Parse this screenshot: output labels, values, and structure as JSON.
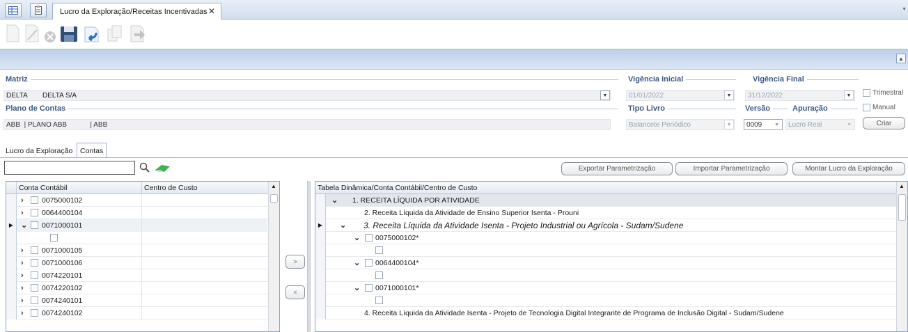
{
  "tabs": {
    "doc_tab_label": "Lucro da Exploração/Receitas Incentivadas",
    "close": "✕"
  },
  "form": {
    "matriz_label": "Matriz",
    "matriz_code": "DELTA",
    "matriz_name": "DELTA S/A",
    "plano_label": "Plano de Contas",
    "plano_value": "ABB  | PLANO ABB            | ABB",
    "vig_ini_label": "Vigência Inicial",
    "vig_ini_value": "01/01/2022",
    "vig_fim_label": "Vigência Final",
    "vig_fim_value": "31/12/2022",
    "trimestral_label": "Trimestral",
    "manual_label": "Manual",
    "tipo_label": "Tipo Livro",
    "tipo_value": "Balancete Periódico",
    "versao_label": "Versão",
    "versao_value": "0009",
    "apuracao_label": "Apuração",
    "apuracao_value": "Lucro Real",
    "criar_label": "Criar"
  },
  "inner_tabs": [
    "Lucro da Exploração",
    "Contas"
  ],
  "actions": {
    "exportar": "Exportar Parametrização",
    "importar": "Importar Parametrização",
    "montar": "Montar Lucro da Exploração"
  },
  "search": {
    "value": ""
  },
  "left_grid": {
    "headers": [
      "Conta Contábil",
      "Centro de Custo"
    ],
    "rows": [
      {
        "exp": ">",
        "code": "0075000102",
        "current": false
      },
      {
        "exp": ">",
        "code": "0064400104",
        "current": false
      },
      {
        "exp": "v",
        "code": "0071000101",
        "current": true
      },
      {
        "exp": "",
        "code": "",
        "current": false,
        "child": true
      },
      {
        "exp": ">",
        "code": "0071000105",
        "current": false
      },
      {
        "exp": ">",
        "code": "0071000106",
        "current": false
      },
      {
        "exp": ">",
        "code": "0074220101",
        "current": false
      },
      {
        "exp": ">",
        "code": "0074220102",
        "current": false
      },
      {
        "exp": ">",
        "code": "0074240101",
        "current": false
      },
      {
        "exp": ">",
        "code": "0074240102",
        "current": false
      }
    ]
  },
  "transfer": {
    "right": ">",
    "left": "<"
  },
  "right_grid": {
    "header": "Tabela Dinâmica/Conta Contábil/Centro de Custo",
    "rows": [
      {
        "level": 0,
        "exp": "v",
        "text": "1. RECEITA LÍQUIDA POR ATIVIDADE",
        "check": false,
        "style": "group"
      },
      {
        "level": 1,
        "exp": "",
        "text": "2. Receita Líquida da Atividade de Ensino Superior Isenta - Prouni",
        "check": false,
        "style": ""
      },
      {
        "level": 1,
        "exp": "v",
        "text": "3. Receita Líquida da Atividade Isenta - Projeto Industrial ou Agrícola - Sudam/Sudene",
        "check": false,
        "style": "italic",
        "current": true
      },
      {
        "level": 2,
        "exp": "v",
        "text": "0075000102*",
        "check": true,
        "style": ""
      },
      {
        "level": 3,
        "exp": "",
        "text": "",
        "check": true,
        "style": ""
      },
      {
        "level": 2,
        "exp": "v",
        "text": "0064400104*",
        "check": true,
        "style": ""
      },
      {
        "level": 3,
        "exp": "",
        "text": "",
        "check": true,
        "style": ""
      },
      {
        "level": 2,
        "exp": "v",
        "text": "0071000101*",
        "check": true,
        "style": ""
      },
      {
        "level": 3,
        "exp": "",
        "text": "",
        "check": true,
        "style": ""
      },
      {
        "level": 1,
        "exp": "",
        "text": "4. Receita Líquida da Atividade Isenta - Projeto de Tecnologia Digital Integrante de Programa de Inclusão Digital - Sudam/Sudene",
        "check": false,
        "style": ""
      }
    ]
  }
}
